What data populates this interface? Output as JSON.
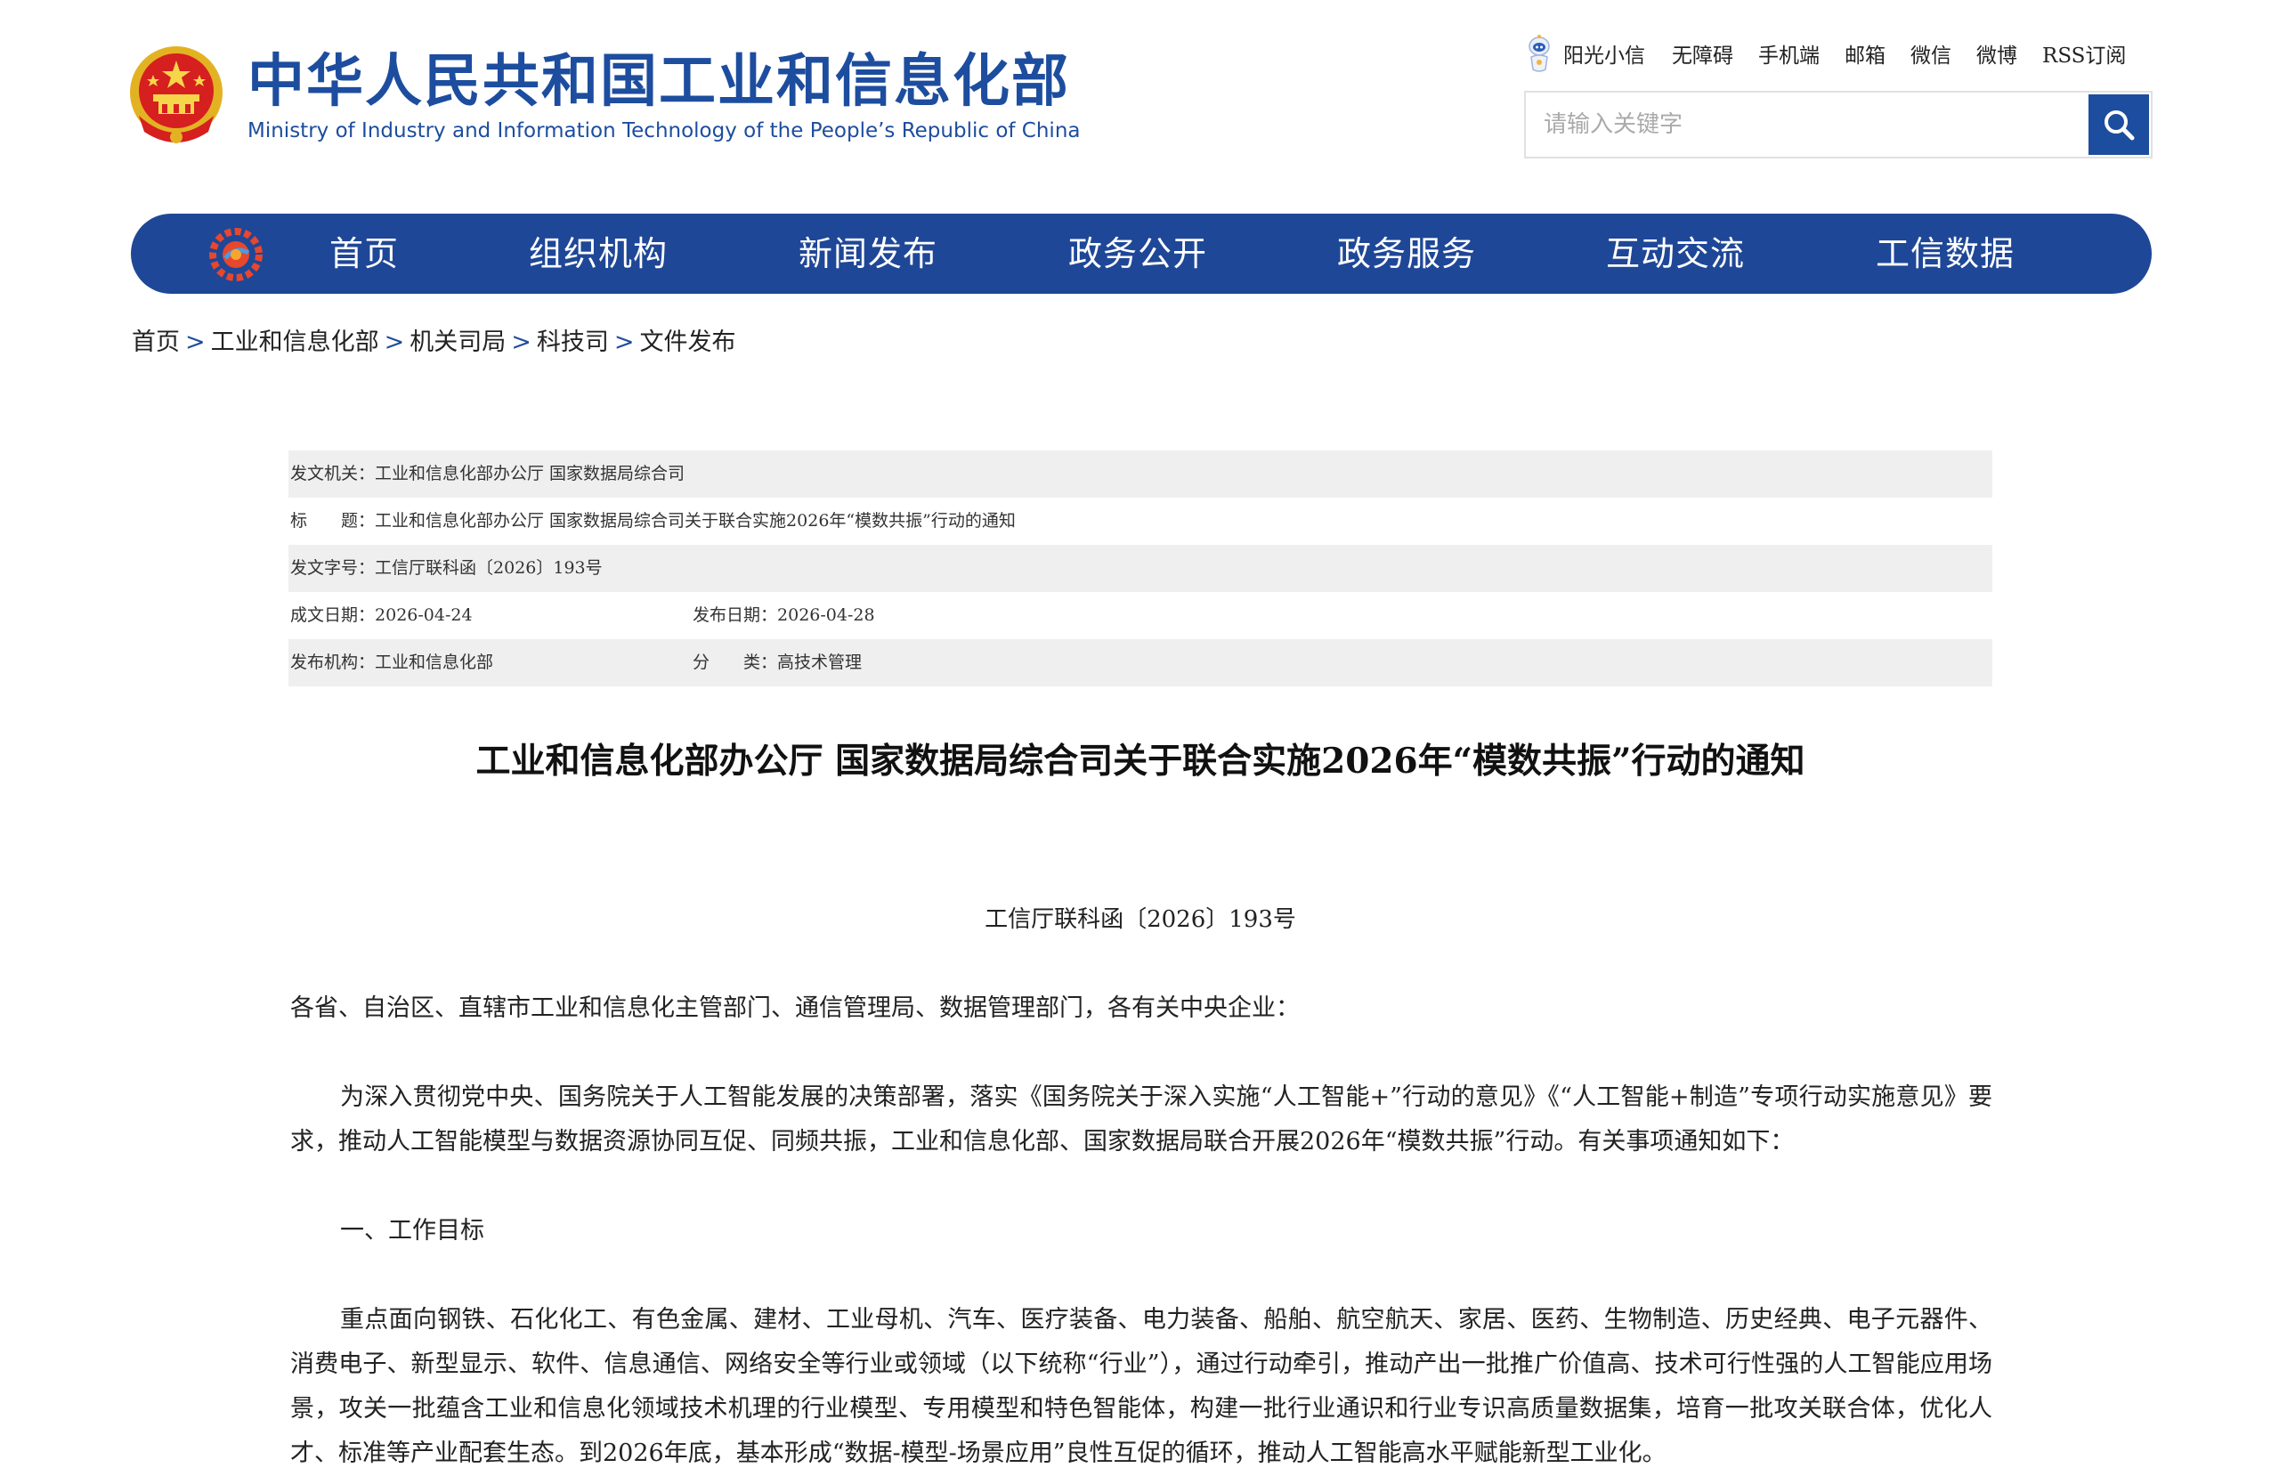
{
  "header": {
    "title_cn": "中华人民共和国工业和信息化部",
    "title_en": "Ministry of Industry and Information Technology of the People’s Republic of China",
    "emblem_icon": "national-emblem-icon",
    "brand_color": "#1d4d9e"
  },
  "toplinks": {
    "sun_label": "阳光小信",
    "items": [
      "无障碍",
      "手机端",
      "邮箱",
      "微信",
      "微博",
      "RSS订阅"
    ]
  },
  "search": {
    "placeholder": "请输入关键字",
    "value": "",
    "icon": "search-icon"
  },
  "nav": {
    "color": "#1f4797",
    "items": [
      "首页",
      "组织机构",
      "新闻发布",
      "政务公开",
      "政务服务",
      "互动交流",
      "工信数据"
    ]
  },
  "breadcrumb": {
    "items": [
      "首页",
      "工业和信息化部",
      "机关司局",
      "科技司",
      "文件发布"
    ],
    "separator": ">"
  },
  "info": {
    "issuer_label": "发文机关：",
    "issuer_value": "工业和信息化部办公厅 国家数据局综合司",
    "title_label": "标　　题：",
    "title_value": "工业和信息化部办公厅 国家数据局综合司关于联合实施2026年“模数共振”行动的通知",
    "docno_label": "发文字号：",
    "docno_value": "工信厅联科函〔2026〕193号",
    "created_label": "成文日期：",
    "created_value": "2026-04-24",
    "published_label": "发布日期：",
    "published_value": "2026-04-28",
    "org_label": "发布机构：",
    "org_value": "工业和信息化部",
    "category_label": "分　　类：",
    "category_value": "高技术管理"
  },
  "article": {
    "title": "工业和信息化部办公厅 国家数据局综合司关于联合实施2026年“模数共振”行动的通知",
    "docno": "工信厅联科函〔2026〕193号",
    "address": "各省、自治区、直辖市工业和信息化主管部门、通信管理局、数据管理部门，各有关中央企业：",
    "intro": "为深入贯彻党中央、国务院关于人工智能发展的决策部署，落实《国务院关于深入实施“人工智能+”行动的意见》《“人工智能+制造”专项行动实施意见》要求，推动人工智能模型与数据资源协同互促、同频共振，工业和信息化部、国家数据局联合开展2026年“模数共振”行动。有关事项通知如下：",
    "section1": "一、工作目标",
    "section1_body": "重点面向钢铁、石化化工、有色金属、建材、工业母机、汽车、医疗装备、电力装备、船舶、航空航天、家居、医药、生物制造、历史经典、电子元器件、消费电子、新型显示、软件、信息通信、网络安全等行业或领域（以下统称“行业”），通过行动牵引，推动产出一批推广价值高、技术可行性强的人工智能应用场景，攻关一批蕴含工业和信息化领域技术机理的行业模型、专用模型和特色智能体，构建一批行业通识和行业专识高质量数据集，培育一批攻关联合体，优化人才、标准等产业配套生态。到2026年底，基本形成“数据-模型-场景应用”良性互促的循环，推动人工智能高水平赋能新型工业化。"
  }
}
